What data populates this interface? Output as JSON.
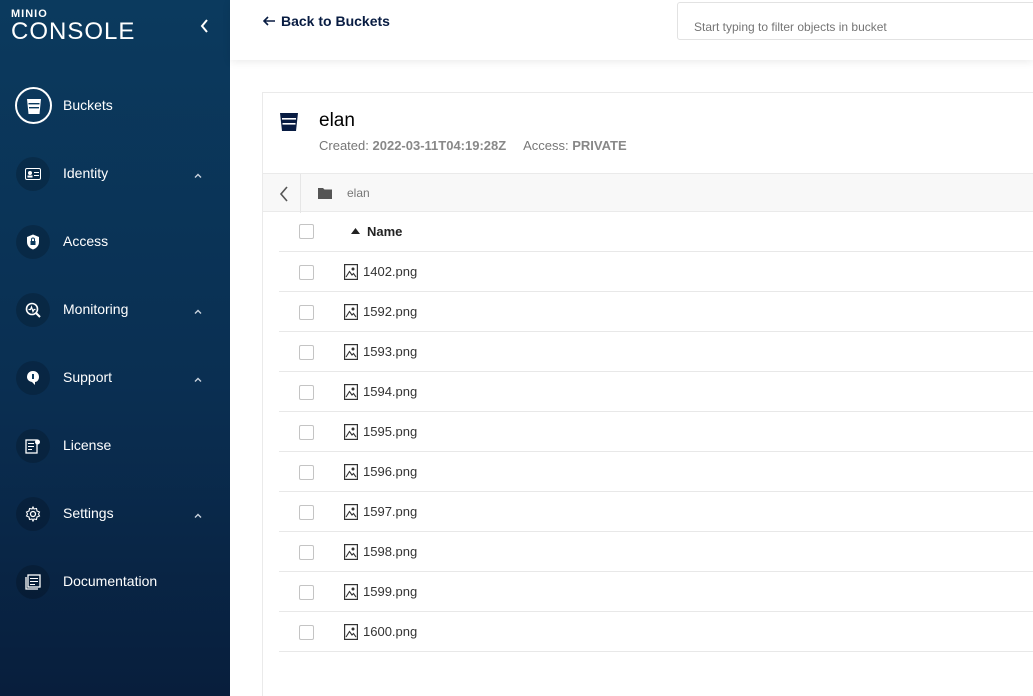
{
  "brand": {
    "mini": "MINIO",
    "console": "CONSOLE"
  },
  "sidebar": {
    "items": [
      {
        "label": "Buckets",
        "icon": "bucket-icon",
        "active": true,
        "expandable": false
      },
      {
        "label": "Identity",
        "icon": "id-card-icon",
        "active": false,
        "expandable": true
      },
      {
        "label": "Access",
        "icon": "shield-lock-icon",
        "active": false,
        "expandable": false
      },
      {
        "label": "Monitoring",
        "icon": "monitoring-icon",
        "active": false,
        "expandable": true
      },
      {
        "label": "Support",
        "icon": "support-icon",
        "active": false,
        "expandable": true
      },
      {
        "label": "License",
        "icon": "license-icon",
        "active": false,
        "expandable": false
      },
      {
        "label": "Settings",
        "icon": "gear-icon",
        "active": false,
        "expandable": true
      },
      {
        "label": "Documentation",
        "icon": "documentation-icon",
        "active": false,
        "expandable": false
      }
    ]
  },
  "topbar": {
    "back_label": "Back to Buckets",
    "filter_placeholder": "Start typing to filter objects in bucket"
  },
  "bucket": {
    "name": "elan",
    "created_label": "Created:",
    "created_value": "2022-03-11T04:19:28Z",
    "access_label": "Access:",
    "access_value": "PRIVATE"
  },
  "breadcrumb": {
    "path": "elan"
  },
  "table": {
    "name_header": "Name",
    "sort": "ascending",
    "files": [
      "1402.png",
      "1592.png",
      "1593.png",
      "1594.png",
      "1595.png",
      "1596.png",
      "1597.png",
      "1598.png",
      "1599.png",
      "1600.png"
    ]
  },
  "colors": {
    "sidebar_top": "#0b3a5e",
    "sidebar_bottom": "#081e3c",
    "text_dark": "#081c42"
  }
}
